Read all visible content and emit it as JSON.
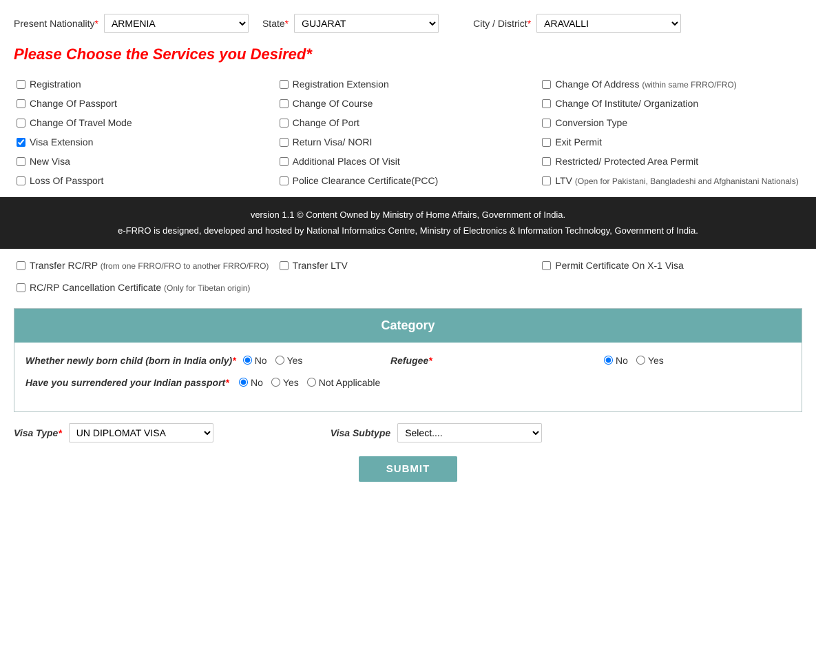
{
  "nationality": {
    "label": "Present Nationality",
    "value": "ARMENIA",
    "options": [
      "ARMENIA"
    ]
  },
  "state": {
    "label": "State",
    "value": "GUJARAT",
    "options": [
      "GUJARAT"
    ]
  },
  "cityDistrict": {
    "label": "City / District",
    "value": "ARAVALLI",
    "options": [
      "ARAVALLI"
    ]
  },
  "servicesHeading": "Please Choose the Services you Desired",
  "services": {
    "col1": [
      {
        "id": "registration",
        "label": "Registration",
        "checked": false
      },
      {
        "id": "changeOfPassport",
        "label": "Change Of Passport",
        "checked": false
      },
      {
        "id": "changeOfTravelMode",
        "label": "Change Of Travel Mode",
        "checked": false
      },
      {
        "id": "visaExtension",
        "label": "Visa Extension",
        "checked": true
      },
      {
        "id": "newVisa",
        "label": "New Visa",
        "checked": false
      },
      {
        "id": "lossOfPassport",
        "label": "Loss Of Passport",
        "checked": false
      }
    ],
    "col2": [
      {
        "id": "registrationExtension",
        "label": "Registration Extension",
        "checked": false
      },
      {
        "id": "changeOfCourse",
        "label": "Change Of Course",
        "checked": false
      },
      {
        "id": "changeOfPort",
        "label": "Change Of Port",
        "checked": false
      },
      {
        "id": "returnVisaNORI",
        "label": "Return Visa/ NORI",
        "checked": false
      },
      {
        "id": "additionalPlaces",
        "label": "Additional Places Of Visit",
        "checked": false
      },
      {
        "id": "policeClearance",
        "label": "Police Clearance Certificate(PCC)",
        "checked": false
      }
    ],
    "col3": [
      {
        "id": "changeOfAddress",
        "label": "Change Of Address",
        "note": "(within same FRRO/FRO)",
        "checked": false
      },
      {
        "id": "changeOfInstitute",
        "label": "Change Of Institute/ Organization",
        "checked": false
      },
      {
        "id": "conversionType",
        "label": "Conversion Type",
        "checked": false
      },
      {
        "id": "exitPermit",
        "label": "Exit Permit",
        "checked": false
      },
      {
        "id": "restrictedArea",
        "label": "Restricted/ Protected Area Permit",
        "checked": false
      },
      {
        "id": "ltv",
        "label": "LTV",
        "note": "(Open for Pakistani, Bangladeshi and Afghanistani Nationals)",
        "checked": false
      }
    ]
  },
  "lowerServices": {
    "row1": [
      {
        "id": "transferRCRP",
        "label": "Transfer RC/RP",
        "note": "(from one FRRO/FRO to another FRRO/FRO)",
        "checked": false
      },
      {
        "id": "transferLTV",
        "label": "Transfer LTV",
        "checked": false
      },
      {
        "id": "permitCertificate",
        "label": "Permit Certificate On X-1 Visa",
        "checked": false
      }
    ],
    "row2": [
      {
        "id": "rcCancellation",
        "label": "RC/RP Cancellation Certificate",
        "note": "(Only for Tibetan origin)",
        "checked": false
      }
    ]
  },
  "footer": {
    "line1": "version 1.1 © Content Owned by Ministry of Home Affairs, Government of India.",
    "line2": "e-FRRO is designed, developed and hosted by National Informatics Centre, Ministry of Electronics & Information Technology, Government of India."
  },
  "category": {
    "heading": "Category",
    "newBornLabel": "Whether newly born child   (born in India only)",
    "newBornNo": true,
    "refugeeLabel": "Refugee",
    "refugeeNo": true,
    "surrenderedLabel": "Have you surrendered your Indian passport",
    "surrenderedNo": true
  },
  "visaSection": {
    "typeLabel": "Visa Type",
    "typeValue": "UN DIPLOMAT VISA",
    "typeOptions": [
      "UN DIPLOMAT VISA"
    ],
    "subtypeLabel": "Visa Subtype",
    "subtypeValue": "Select....",
    "subtypeOptions": [
      "Select...."
    ]
  },
  "submitBtn": "SUBMIT"
}
